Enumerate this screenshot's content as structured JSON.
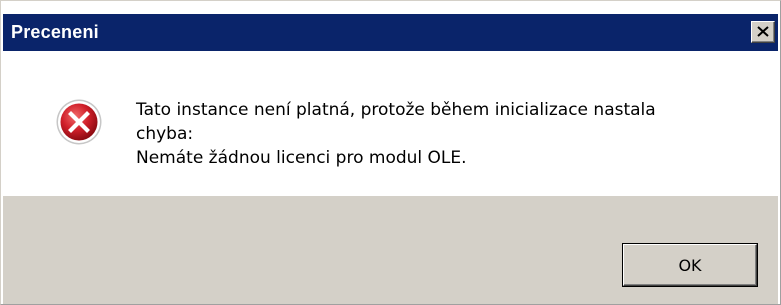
{
  "window": {
    "title": "Preceneni"
  },
  "message": {
    "lines": [
      "Tato instance není platná, protože během inicializace nastala",
      "chyba:",
      "Nemáte žádnou licenci pro modul OLE."
    ],
    "icon": "error-icon"
  },
  "buttons": {
    "ok_label": "OK",
    "close_icon": "close-icon"
  },
  "colors": {
    "titlebar": "#0a246a",
    "footer": "#d4d0c8",
    "error_red": "#c8202a"
  }
}
